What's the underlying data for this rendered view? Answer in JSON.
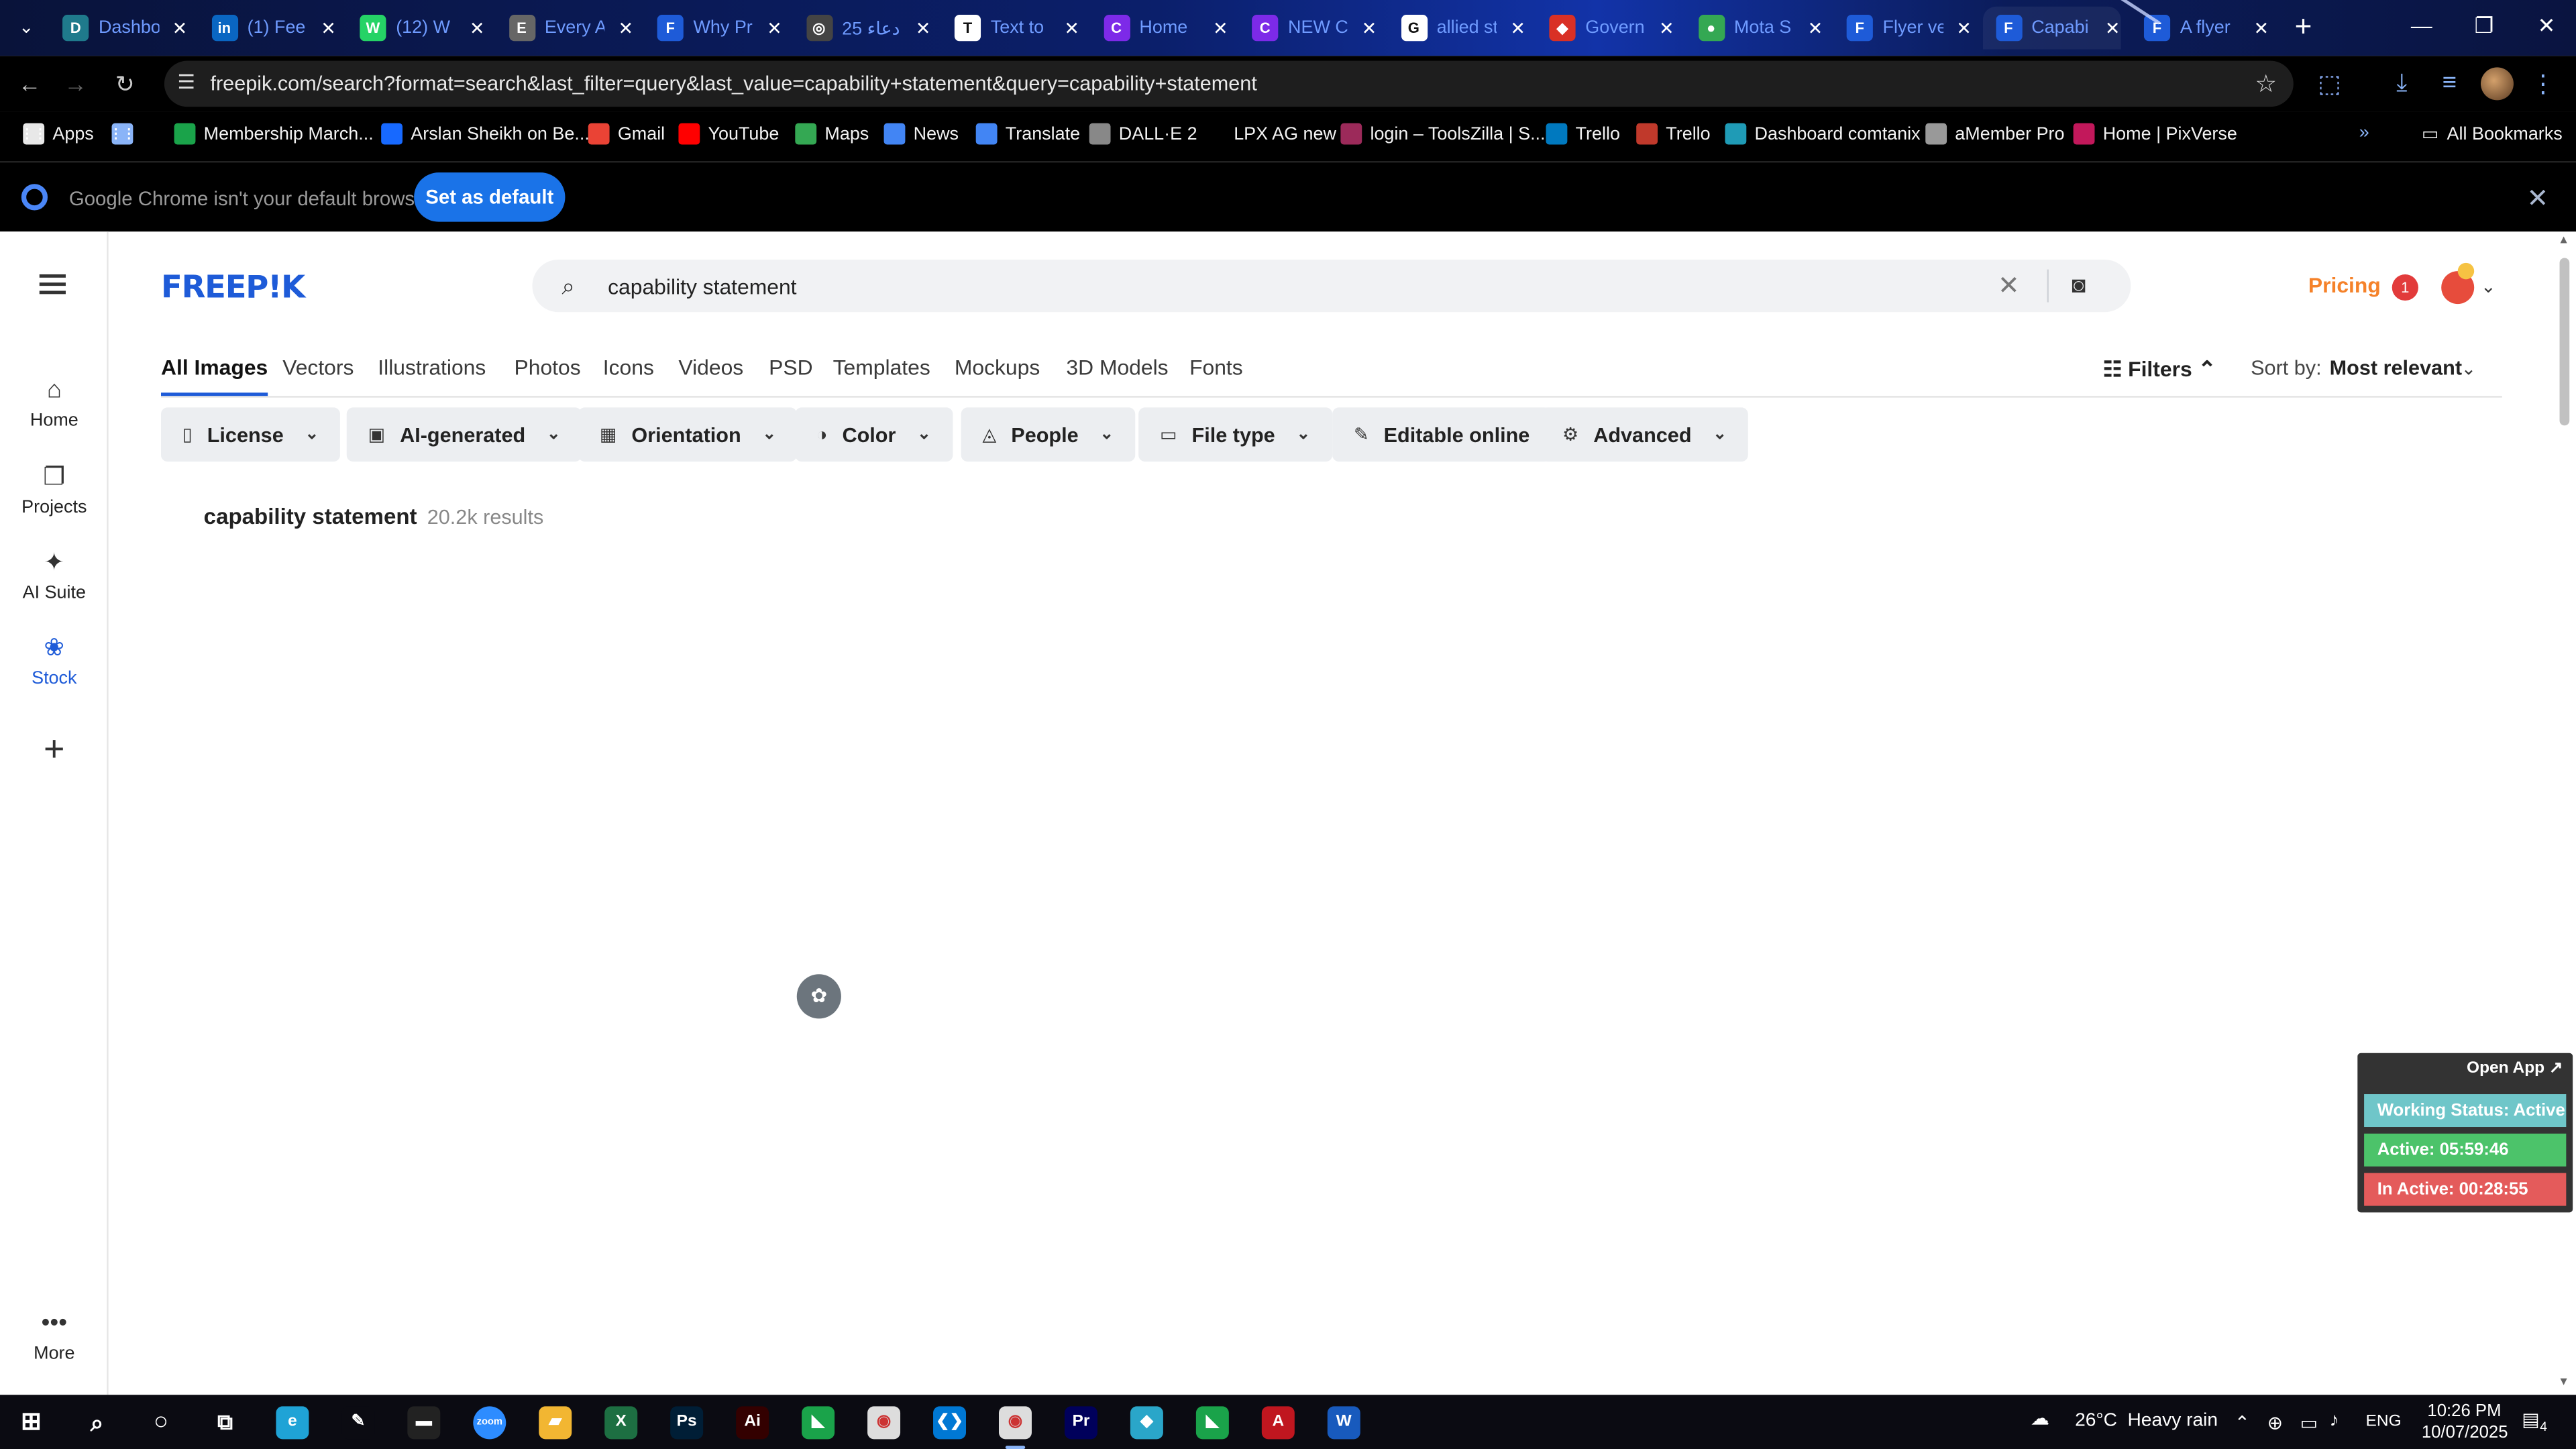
{
  "browser": {
    "tabs": [
      {
        "title": "Dashbo",
        "icon": "Dashboard",
        "color": "#1f7a8c",
        "glyph": "D"
      },
      {
        "title": "(1) Fee",
        "icon": "LinkedIn",
        "color": "#0a66c2",
        "glyph": "in"
      },
      {
        "title": "(12) W",
        "icon": "WhatsApp",
        "color": "#25d366",
        "glyph": "W"
      },
      {
        "title": "Every A",
        "icon": "Globe",
        "color": "#666666",
        "glyph": "E"
      },
      {
        "title": "Why Pr",
        "icon": "Freepik",
        "color": "#1e5bd8",
        "glyph": "F"
      },
      {
        "title": "25 دعاء",
        "icon": "Web",
        "color": "#444444",
        "glyph": "◎"
      },
      {
        "title": "Text to",
        "icon": "Text",
        "color": "#ffffff",
        "glyph": "T"
      },
      {
        "title": "Home",
        "icon": "Canva",
        "color": "#7d2ae8",
        "glyph": "C"
      },
      {
        "title": "NEW C",
        "icon": "Canva",
        "color": "#7d2ae8",
        "glyph": "C"
      },
      {
        "title": "allied st",
        "icon": "Google",
        "color": "#ffffff",
        "glyph": "G"
      },
      {
        "title": "Govern",
        "icon": "Gov",
        "color": "#d93025",
        "glyph": "◆"
      },
      {
        "title": "Mota S",
        "icon": "Maps",
        "color": "#34a853",
        "glyph": "●"
      },
      {
        "title": "Flyer ve",
        "icon": "Freepik",
        "color": "#1e5bd8",
        "glyph": "F"
      },
      {
        "title": "Capabi",
        "icon": "Freepik",
        "color": "#1e5bd8",
        "glyph": "F"
      },
      {
        "title": "A flyer",
        "icon": "Freepik",
        "color": "#1e5bd8",
        "glyph": "F"
      }
    ],
    "url": "freepik.com/search?format=search&last_filter=query&last_value=capability+statement&query=capability+statement",
    "bookmarks": [
      {
        "label": "Apps",
        "icon": "apps-grid",
        "color": "#e8e8e8"
      },
      {
        "label": "",
        "icon": "grid-icon",
        "color": "#8ab4f8"
      },
      {
        "label": "Membership March...",
        "icon": "bookmark",
        "color": "#1aa34a"
      },
      {
        "label": "Arslan Sheikh on Be...",
        "icon": "behance",
        "color": "#1769ff"
      },
      {
        "label": "Gmail",
        "icon": "gmail",
        "color": "#ea4335"
      },
      {
        "label": "YouTube",
        "icon": "youtube",
        "color": "#ff0000"
      },
      {
        "label": "Maps",
        "icon": "maps",
        "color": "#34a853"
      },
      {
        "label": "News",
        "icon": "news",
        "color": "#4285f4"
      },
      {
        "label": "Translate",
        "icon": "translate",
        "color": "#4285f4"
      },
      {
        "label": "DALL·E 2",
        "icon": "openai",
        "color": "#888888"
      },
      {
        "label": "LPX AG new",
        "icon": "blank",
        "color": "#000000"
      },
      {
        "label": "login – ToolsZilla | S...",
        "icon": "toolszilla",
        "color": "#9c2a5a"
      },
      {
        "label": "Trello",
        "icon": "trello",
        "color": "#0079bf"
      },
      {
        "label": "Trello",
        "icon": "trello",
        "color": "#c0392b"
      },
      {
        "label": "Dashboard comtanix",
        "icon": "comtanix",
        "color": "#1f9bb6"
      },
      {
        "label": "aMember Pro",
        "icon": "amember",
        "color": "#999999"
      },
      {
        "label": "Home | PixVerse",
        "icon": "pixverse",
        "color": "#c2185b"
      }
    ],
    "all_bookmarks": "All Bookmarks",
    "infobar": {
      "message": "Google Chrome isn't your default browser",
      "button": "Set as default"
    }
  },
  "site": {
    "logo": "FREEP!K",
    "search_value": "capability statement",
    "pricing": "Pricing",
    "notifications": "1",
    "sidebar": [
      {
        "label": "Home",
        "icon": "home-icon",
        "glyph": "⌂"
      },
      {
        "label": "Projects",
        "icon": "projects-icon",
        "glyph": "❐"
      },
      {
        "label": "AI Suite",
        "icon": "ai-suite-icon",
        "glyph": "✦"
      },
      {
        "label": "Stock",
        "icon": "stock-icon",
        "glyph": "❀"
      }
    ],
    "more": "More",
    "content_tabs": [
      "All Images",
      "Vectors",
      "Illustrations",
      "Photos",
      "Icons",
      "Videos",
      "PSD",
      "Templates",
      "Mockups",
      "3D Models",
      "Fonts"
    ],
    "filters_label": "Filters",
    "sort_label": "Sort by:",
    "sort_value": "Most relevant",
    "chips": [
      {
        "label": "License",
        "icon": "license-icon",
        "glyph": "▯"
      },
      {
        "label": "AI-generated",
        "icon": "ai-generated-icon",
        "glyph": "▣"
      },
      {
        "label": "Orientation",
        "icon": "orientation-icon",
        "glyph": "▦"
      },
      {
        "label": "Color",
        "icon": "color-icon",
        "glyph": "◑"
      },
      {
        "label": "People",
        "icon": "people-icon",
        "glyph": "◬"
      },
      {
        "label": "File type",
        "icon": "file-type-icon",
        "glyph": "▭"
      }
    ],
    "chip_editable": "Editable online",
    "chip_advanced": "Advanced",
    "result_query": "capability statement",
    "result_count": "20.2k results"
  },
  "widget": {
    "open_app": "Open App ↗",
    "status": "Working Status: Active",
    "active": "Active: 05:59:46",
    "inactive": "In Active: 00:28:55",
    "colors": {
      "status": "#6fc6c9",
      "active": "#4cc36a",
      "inactive": "#e45b5b"
    }
  },
  "taskbar": {
    "weather_temp": "26°C",
    "weather_text": "Heavy rain",
    "lang": "ENG",
    "time": "10:26 PM",
    "date": "10/07/2025",
    "notifications": "4",
    "apps": [
      {
        "name": "edge",
        "color": "#1fa3d6",
        "glyph": "e"
      },
      {
        "name": "pen",
        "color": "#0b0b12",
        "glyph": "✎"
      },
      {
        "name": "terminal",
        "color": "#222222",
        "glyph": "▬"
      },
      {
        "name": "zoom",
        "color": "#2d8cff",
        "glyph": "zoom"
      },
      {
        "name": "explorer",
        "color": "#f2b632",
        "glyph": "▰"
      },
      {
        "name": "excel",
        "color": "#1d6f42",
        "glyph": "X"
      },
      {
        "name": "photoshop",
        "color": "#001e36",
        "glyph": "Ps"
      },
      {
        "name": "illustrator",
        "color": "#330000",
        "glyph": "Ai"
      },
      {
        "name": "app-green",
        "color": "#1aa34a",
        "glyph": "◣"
      },
      {
        "name": "chrome",
        "color": "#dddddd",
        "glyph": "◉"
      },
      {
        "name": "vscode",
        "color": "#0078d4",
        "glyph": "❮❯"
      },
      {
        "name": "chrome-active",
        "color": "#dddddd",
        "glyph": "◉"
      },
      {
        "name": "premiere",
        "color": "#00005b",
        "glyph": "Pr"
      },
      {
        "name": "app-teal",
        "color": "#2aa6c9",
        "glyph": "◆"
      },
      {
        "name": "app-green2",
        "color": "#1aa34a",
        "glyph": "◣"
      },
      {
        "name": "acrobat",
        "color": "#c0161f",
        "glyph": "A"
      },
      {
        "name": "word",
        "color": "#185abd",
        "glyph": "W"
      }
    ]
  }
}
